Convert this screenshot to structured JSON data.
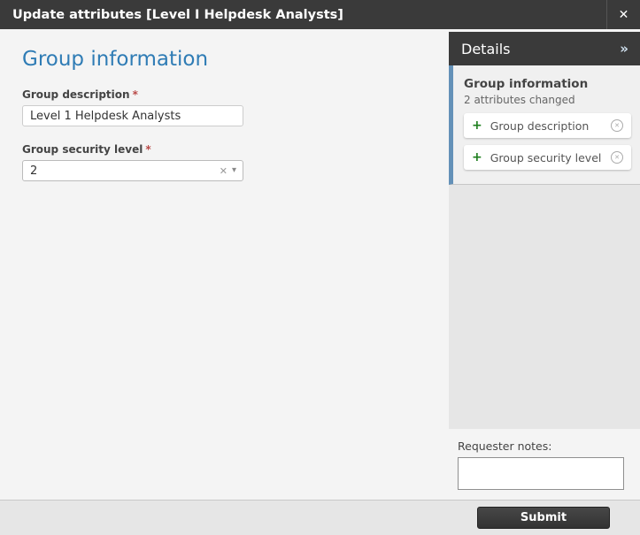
{
  "titlebar": {
    "title": "Update attributes [Level I Helpdesk Analysts]",
    "close_icon": "✕"
  },
  "form": {
    "heading": "Group information",
    "required_mark": "*",
    "fields": [
      {
        "label": "Group description",
        "value": "Level 1 Helpdesk Analysts"
      },
      {
        "label": "Group security level",
        "value": "2",
        "clear_icon": "✕",
        "caret_icon": "▾"
      }
    ]
  },
  "details": {
    "header": "Details",
    "collapse_icon": "»",
    "add_icon": "+",
    "revert_icon": "✕",
    "section": {
      "title": "Group information",
      "subtitle": "2 attributes changed",
      "changes": [
        {
          "label": "Group description"
        },
        {
          "label": "Group security level"
        }
      ]
    },
    "notes_label": "Requester notes:",
    "notes_value": ""
  },
  "footer": {
    "submit_label": "Submit"
  },
  "colors": {
    "titlebar_bg": "#3a3a3a",
    "heading_blue": "#2f7cb5",
    "accent_blue": "#6491b8",
    "required_red": "#b94a48",
    "added_green": "#1c7e1c"
  }
}
